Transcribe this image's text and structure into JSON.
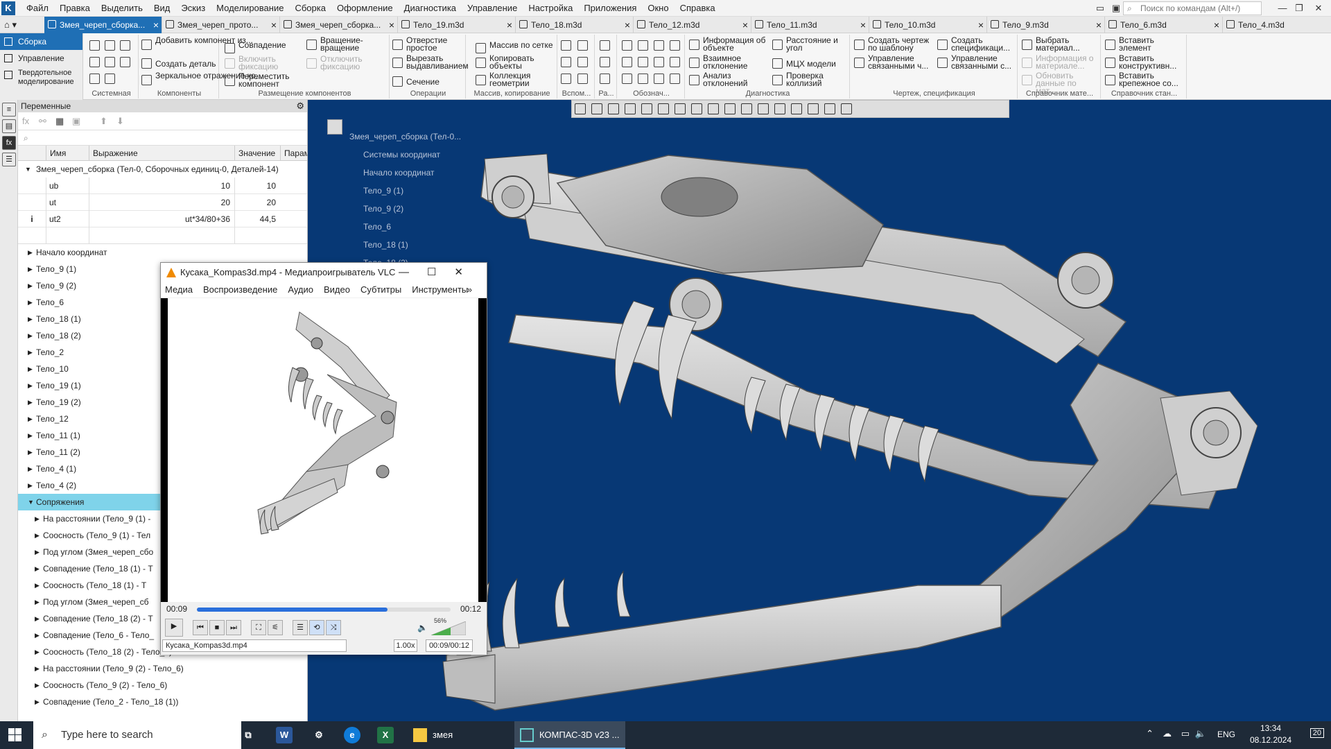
{
  "app": {
    "menu": [
      "Файл",
      "Правка",
      "Выделить",
      "Вид",
      "Эскиз",
      "Моделирование",
      "Сборка",
      "Оформление",
      "Диагностика",
      "Управление",
      "Настройка",
      "Приложения",
      "Окно",
      "Справка"
    ],
    "command_search_placeholder": "Поиск по командам (Alt+/)"
  },
  "tabs": [
    {
      "label": "Змея_череп_сборка...",
      "active": true
    },
    {
      "label": "Змея_череп_прото...",
      "active": false
    },
    {
      "label": "Змея_череп_сборка...",
      "active": false
    },
    {
      "label": "Тело_19.m3d",
      "active": false
    },
    {
      "label": "Тело_18.m3d",
      "active": false
    },
    {
      "label": "Тело_12.m3d",
      "active": false
    },
    {
      "label": "Тело_11.m3d",
      "active": false
    },
    {
      "label": "Тело_10.m3d",
      "active": false
    },
    {
      "label": "Тело_9.m3d",
      "active": false
    },
    {
      "label": "Тело_6.m3d",
      "active": false
    },
    {
      "label": "Тело_4.m3d",
      "active": false
    }
  ],
  "ribbon": {
    "modes": [
      "Сборка",
      "Управление",
      "Твердотельное моделирование"
    ],
    "groups": {
      "system": "Системная",
      "components": "Компоненты",
      "placement": "Размещение компонентов",
      "operations": "Операции",
      "array": "Массив, копирование",
      "aux": "Вспом...",
      "size": "Ра...",
      "notation": "Обознач...",
      "diagnostics": "Диагностика",
      "drawing": "Чертеж, спецификация",
      "reference_mat": "Справочник мате...",
      "reference_std": "Справочник стан..."
    },
    "buttons": {
      "add_component": "Добавить компонент из...",
      "create_part": "Создать деталь",
      "mirror": "Зеркальное отражение ко...",
      "coincidence": "Совпадение",
      "enable_fix": "Включить фиксацию",
      "disable_fix": "Отключить фиксацию",
      "move_comp": "Переместить компонент",
      "rotation": "Вращение-вращение",
      "hole": "Отверстие простое",
      "cut_extrude": "Вырезать выдавливанием",
      "section": "Сечение",
      "array_grid": "Массив по сетке",
      "copy_objects": "Копировать объекты",
      "geom_collection": "Коллекция геометрии",
      "obj_info": "Информация об объекте",
      "deviation": "Взаимное отклонение",
      "analysis": "Анализ отклонений",
      "dist_angle": "Расстояние и угол",
      "mcx": "МЦХ модели",
      "collision": "Проверка коллизий",
      "create_drawing": "Создать чертеж по шаблону",
      "manage_linked": "Управление связанными ч...",
      "create_spec": "Создать спецификаци...",
      "manage_linked2": "Управление связанными с...",
      "select_material": "Выбрать материал...",
      "material_info": "Информация о материале...",
      "update_data": "Обновить данные по мат...",
      "insert_element": "Вставить элемент",
      "insert_construct": "Вставить конструктивн...",
      "insert_fastener": "Вставить крепежное со..."
    }
  },
  "variables": {
    "title": "Переменные",
    "columns": [
      "Имя",
      "Выражение",
      "Значение",
      "Парам"
    ],
    "root": "Змея_череп_сборка (Тел-0, Сборочных единиц-0, Деталей-14)",
    "rows": [
      {
        "name": "ub",
        "expr": "10",
        "value": "10",
        "mark": ""
      },
      {
        "name": "ut",
        "expr": "20",
        "value": "20",
        "mark": ""
      },
      {
        "name": "ut2",
        "expr": "ut*34/80+36",
        "value": "44,5",
        "mark": "i"
      }
    ],
    "tree": [
      {
        "label": "Начало координат",
        "indent": 0,
        "open": false,
        "selected": false
      },
      {
        "label": "Тело_9 (1)",
        "indent": 0,
        "open": false,
        "selected": false
      },
      {
        "label": "Тело_9 (2)",
        "indent": 0,
        "open": false,
        "selected": false
      },
      {
        "label": "Тело_6",
        "indent": 0,
        "open": false,
        "selected": false
      },
      {
        "label": "Тело_18 (1)",
        "indent": 0,
        "open": false,
        "selected": false
      },
      {
        "label": "Тело_18 (2)",
        "indent": 0,
        "open": false,
        "selected": false
      },
      {
        "label": "Тело_2",
        "indent": 0,
        "open": false,
        "selected": false
      },
      {
        "label": "Тело_10",
        "indent": 0,
        "open": false,
        "selected": false
      },
      {
        "label": "Тело_19 (1)",
        "indent": 0,
        "open": false,
        "selected": false
      },
      {
        "label": "Тело_19 (2)",
        "indent": 0,
        "open": false,
        "selected": false
      },
      {
        "label": "Тело_12",
        "indent": 0,
        "open": false,
        "selected": false
      },
      {
        "label": "Тело_11 (1)",
        "indent": 0,
        "open": false,
        "selected": false
      },
      {
        "label": "Тело_11 (2)",
        "indent": 0,
        "open": false,
        "selected": false
      },
      {
        "label": "Тело_4 (1)",
        "indent": 0,
        "open": false,
        "selected": false
      },
      {
        "label": "Тело_4 (2)",
        "indent": 0,
        "open": false,
        "selected": false
      },
      {
        "label": "Сопряжения",
        "indent": 0,
        "open": true,
        "selected": true
      },
      {
        "label": "На расстоянии (Тело_9 (1) - ",
        "indent": 1,
        "open": false,
        "selected": false
      },
      {
        "label": "Соосность (Тело_9 (1) - Тел",
        "indent": 1,
        "open": false,
        "selected": false
      },
      {
        "label": "Под углом (Змея_череп_сбо",
        "indent": 1,
        "open": false,
        "selected": false
      },
      {
        "label": "Совпадение (Тело_18 (1) - Т",
        "indent": 1,
        "open": false,
        "selected": false
      },
      {
        "label": "Соосность (Тело_18 (1) - Т",
        "indent": 1,
        "open": false,
        "selected": false
      },
      {
        "label": "Под углом (Змея_череп_сб",
        "indent": 1,
        "open": false,
        "selected": false
      },
      {
        "label": "Совпадение (Тело_18 (2) - T",
        "indent": 1,
        "open": false,
        "selected": false
      },
      {
        "label": "Совпадение (Тело_6 - Тело_",
        "indent": 1,
        "open": false,
        "selected": false
      },
      {
        "label": "Соосность (Тело_18 (2) - Тело_6)",
        "indent": 1,
        "open": false,
        "selected": false
      },
      {
        "label": "На расстоянии (Тело_9 (2) - Тело_6)",
        "indent": 1,
        "open": false,
        "selected": false
      },
      {
        "label": "Соосность (Тело_9 (2) - Тело_6)",
        "indent": 1,
        "open": false,
        "selected": false
      },
      {
        "label": "Совпадение (Тело_2 - Тело_18 (1))",
        "indent": 1,
        "open": false,
        "selected": false
      }
    ]
  },
  "viewport_tree": [
    "Змея_череп_сборка (Тел-0...",
    "Системы координат",
    "Начало координат",
    "Тело_9 (1)",
    "Тело_9 (2)",
    "Тело_6",
    "Тело_18 (1)",
    "Тело_18 (2)"
  ],
  "vlc": {
    "title": "Кусака_Kompas3d.mp4 - Медиапроигрыватель VLC",
    "menu": [
      "Медиа",
      "Воспроизведение",
      "Аудио",
      "Видео",
      "Субтитры",
      "Инструменты"
    ],
    "elapsed": "00:09",
    "total": "00:12",
    "progress": 0.75,
    "volume": "56%",
    "filename": "Кусака_Kompas3d.mp4",
    "speed": "1.00x",
    "time_display": "00:09/00:12"
  },
  "taskbar": {
    "search_placeholder": "Type here to search",
    "folder": "змея",
    "kompas": "КОМПАС-3D v23 ...",
    "lang": "ENG",
    "time": "13:34",
    "date": "08.12.2024",
    "notif": "20"
  },
  "colors": {
    "accent": "#1f6fb5",
    "viewport": "#073875",
    "selection": "#7fd3ea"
  }
}
